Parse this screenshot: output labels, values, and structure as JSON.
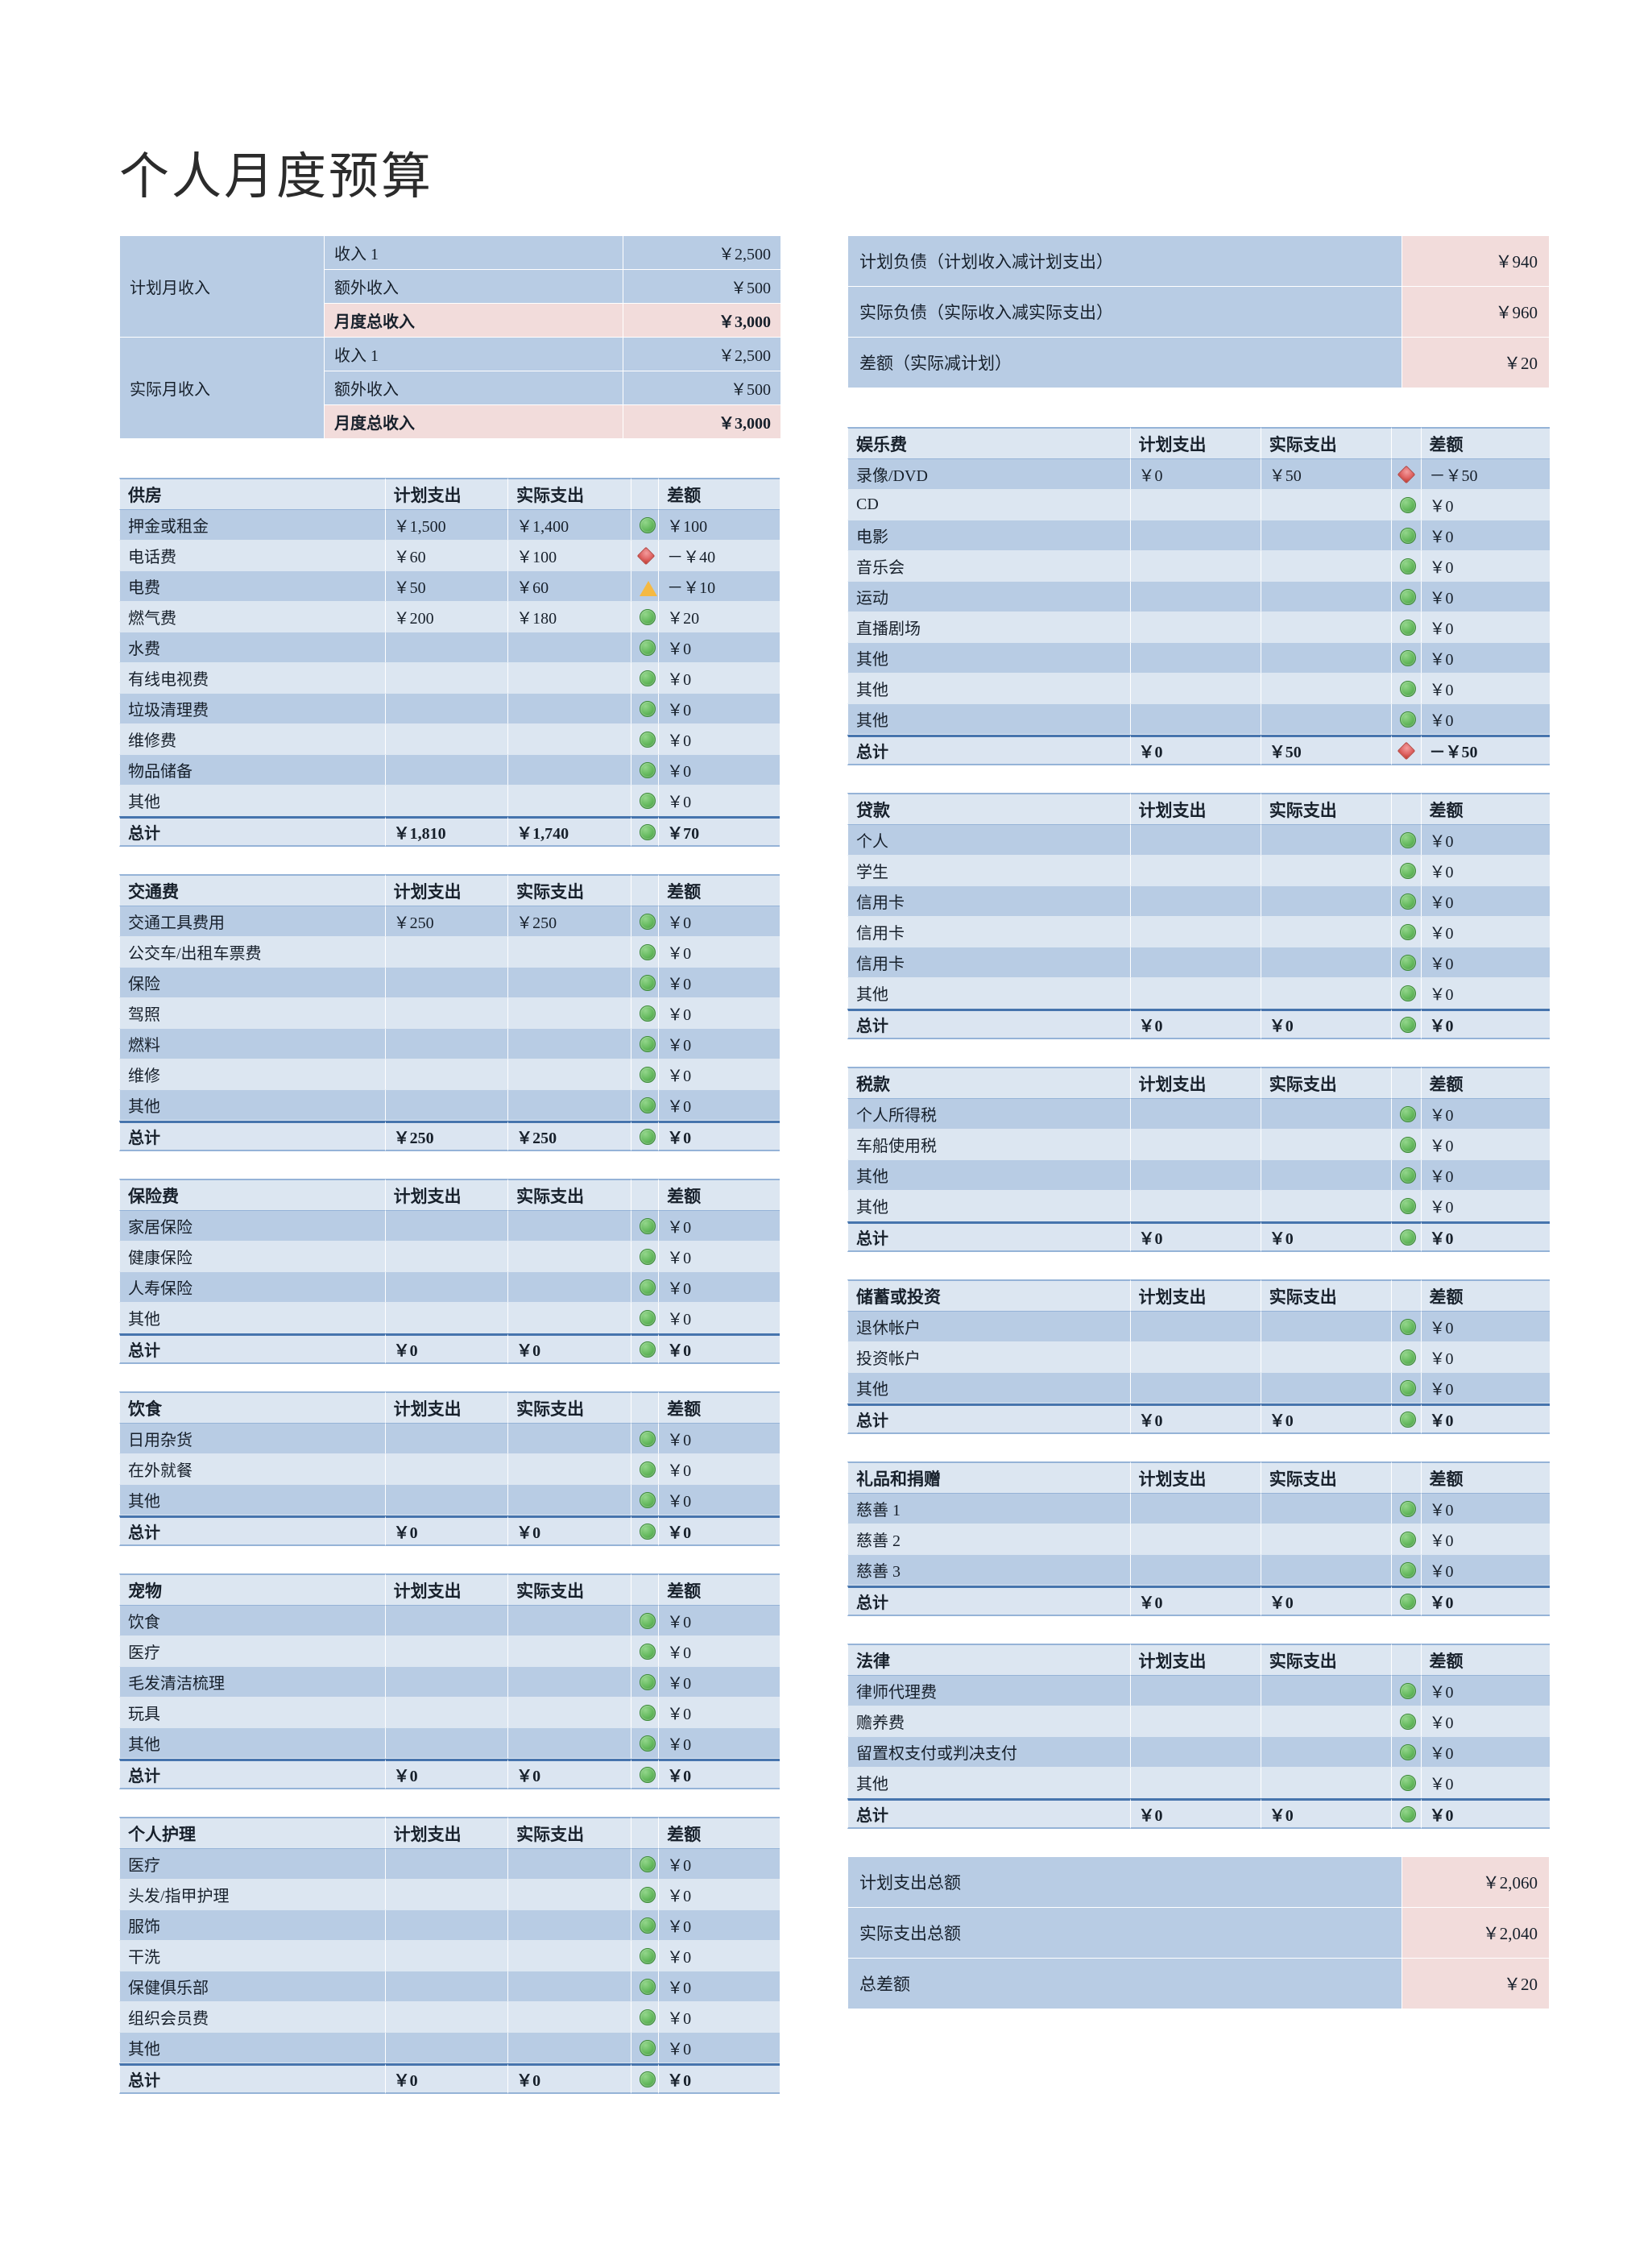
{
  "title": "个人月度预算",
  "currency_symbol": "¥",
  "income": {
    "planned_label": "计划月收入",
    "actual_label": "实际月收入",
    "planned_rows": [
      {
        "name": "收入 1",
        "value": "￥2,500",
        "total": false
      },
      {
        "name": "额外收入",
        "value": "￥500",
        "total": false
      },
      {
        "name": "月度总收入",
        "value": "￥3,000",
        "total": true
      }
    ],
    "actual_rows": [
      {
        "name": "收入 1",
        "value": "￥2,500",
        "total": false
      },
      {
        "name": "额外收入",
        "value": "￥500",
        "total": false
      },
      {
        "name": "月度总收入",
        "value": "￥3,000",
        "total": true
      }
    ]
  },
  "summary_top": [
    {
      "label": "计划负债（计划收入减计划支出）",
      "value": "￥940"
    },
    {
      "label": "实际负债（实际收入减实际支出）",
      "value": "￥960"
    },
    {
      "label": "差额（实际减计划）",
      "value": "￥20"
    }
  ],
  "headers": {
    "plan": "计划支出",
    "actual": "实际支出",
    "diff": "差额",
    "total": "总计"
  },
  "left_sections": [
    {
      "name": "供房",
      "rows": [
        {
          "name": "押金或租金",
          "plan": "￥1,500",
          "actual": "￥1,400",
          "icon": "green",
          "diff": "￥100"
        },
        {
          "name": "电话费",
          "plan": "￥60",
          "actual": "￥100",
          "icon": "red",
          "diff": "－￥40"
        },
        {
          "name": "电费",
          "plan": "￥50",
          "actual": "￥60",
          "icon": "yellow",
          "diff": "－￥10"
        },
        {
          "name": "燃气费",
          "plan": "￥200",
          "actual": "￥180",
          "icon": "green",
          "diff": "￥20"
        },
        {
          "name": "水费",
          "plan": "",
          "actual": "",
          "icon": "green",
          "diff": "￥0"
        },
        {
          "name": "有线电视费",
          "plan": "",
          "actual": "",
          "icon": "green",
          "diff": "￥0"
        },
        {
          "name": "垃圾清理费",
          "plan": "",
          "actual": "",
          "icon": "green",
          "diff": "￥0"
        },
        {
          "name": "维修费",
          "plan": "",
          "actual": "",
          "icon": "green",
          "diff": "￥0"
        },
        {
          "name": "物品储备",
          "plan": "",
          "actual": "",
          "icon": "green",
          "diff": "￥0"
        },
        {
          "name": "其他",
          "plan": "",
          "actual": "",
          "icon": "green",
          "diff": "￥0"
        }
      ],
      "total": {
        "name": "总计",
        "plan": "￥1,810",
        "actual": "￥1,740",
        "icon": "green",
        "diff": "￥70"
      }
    },
    {
      "name": "交通费",
      "rows": [
        {
          "name": "交通工具费用",
          "plan": "￥250",
          "actual": "￥250",
          "icon": "green",
          "diff": "￥0"
        },
        {
          "name": "公交车/出租车票费",
          "plan": "",
          "actual": "",
          "icon": "green",
          "diff": "￥0"
        },
        {
          "name": "保险",
          "plan": "",
          "actual": "",
          "icon": "green",
          "diff": "￥0"
        },
        {
          "name": "驾照",
          "plan": "",
          "actual": "",
          "icon": "green",
          "diff": "￥0"
        },
        {
          "name": "燃料",
          "plan": "",
          "actual": "",
          "icon": "green",
          "diff": "￥0"
        },
        {
          "name": "维修",
          "plan": "",
          "actual": "",
          "icon": "green",
          "diff": "￥0"
        },
        {
          "name": "其他",
          "plan": "",
          "actual": "",
          "icon": "green",
          "diff": "￥0"
        }
      ],
      "total": {
        "name": "总计",
        "plan": "￥250",
        "actual": "￥250",
        "icon": "green",
        "diff": "￥0"
      }
    },
    {
      "name": "保险费",
      "rows": [
        {
          "name": "家居保险",
          "plan": "",
          "actual": "",
          "icon": "green",
          "diff": "￥0"
        },
        {
          "name": "健康保险",
          "plan": "",
          "actual": "",
          "icon": "green",
          "diff": "￥0"
        },
        {
          "name": "人寿保险",
          "plan": "",
          "actual": "",
          "icon": "green",
          "diff": "￥0"
        },
        {
          "name": "其他",
          "plan": "",
          "actual": "",
          "icon": "green",
          "diff": "￥0"
        }
      ],
      "total": {
        "name": "总计",
        "plan": "￥0",
        "actual": "￥0",
        "icon": "green",
        "diff": "￥0"
      }
    },
    {
      "name": "饮食",
      "rows": [
        {
          "name": "日用杂货",
          "plan": "",
          "actual": "",
          "icon": "green",
          "diff": "￥0"
        },
        {
          "name": "在外就餐",
          "plan": "",
          "actual": "",
          "icon": "green",
          "diff": "￥0"
        },
        {
          "name": "其他",
          "plan": "",
          "actual": "",
          "icon": "green",
          "diff": "￥0"
        }
      ],
      "total": {
        "name": "总计",
        "plan": "￥0",
        "actual": "￥0",
        "icon": "green",
        "diff": "￥0"
      }
    },
    {
      "name": "宠物",
      "rows": [
        {
          "name": "饮食",
          "plan": "",
          "actual": "",
          "icon": "green",
          "diff": "￥0"
        },
        {
          "name": "医疗",
          "plan": "",
          "actual": "",
          "icon": "green",
          "diff": "￥0"
        },
        {
          "name": "毛发清洁梳理",
          "plan": "",
          "actual": "",
          "icon": "green",
          "diff": "￥0"
        },
        {
          "name": "玩具",
          "plan": "",
          "actual": "",
          "icon": "green",
          "diff": "￥0"
        },
        {
          "name": "其他",
          "plan": "",
          "actual": "",
          "icon": "green",
          "diff": "￥0"
        }
      ],
      "total": {
        "name": "总计",
        "plan": "￥0",
        "actual": "￥0",
        "icon": "green",
        "diff": "￥0"
      }
    },
    {
      "name": "个人护理",
      "rows": [
        {
          "name": "医疗",
          "plan": "",
          "actual": "",
          "icon": "green",
          "diff": "￥0"
        },
        {
          "name": "头发/指甲护理",
          "plan": "",
          "actual": "",
          "icon": "green",
          "diff": "￥0"
        },
        {
          "name": "服饰",
          "plan": "",
          "actual": "",
          "icon": "green",
          "diff": "￥0"
        },
        {
          "name": "干洗",
          "plan": "",
          "actual": "",
          "icon": "green",
          "diff": "￥0"
        },
        {
          "name": "保健俱乐部",
          "plan": "",
          "actual": "",
          "icon": "green",
          "diff": "￥0"
        },
        {
          "name": "组织会员费",
          "plan": "",
          "actual": "",
          "icon": "green",
          "diff": "￥0"
        },
        {
          "name": "其他",
          "plan": "",
          "actual": "",
          "icon": "green",
          "diff": "￥0"
        }
      ],
      "total": {
        "name": "总计",
        "plan": "￥0",
        "actual": "￥0",
        "icon": "green",
        "diff": "￥0"
      }
    }
  ],
  "right_sections": [
    {
      "name": "娱乐费",
      "rows": [
        {
          "name": "录像/DVD",
          "plan": "￥0",
          "actual": "￥50",
          "icon": "red",
          "diff": "－￥50"
        },
        {
          "name": "CD",
          "plan": "",
          "actual": "",
          "icon": "green",
          "diff": "￥0"
        },
        {
          "name": "电影",
          "plan": "",
          "actual": "",
          "icon": "green",
          "diff": "￥0"
        },
        {
          "name": "音乐会",
          "plan": "",
          "actual": "",
          "icon": "green",
          "diff": "￥0"
        },
        {
          "name": "运动",
          "plan": "",
          "actual": "",
          "icon": "green",
          "diff": "￥0"
        },
        {
          "name": "直播剧场",
          "plan": "",
          "actual": "",
          "icon": "green",
          "diff": "￥0"
        },
        {
          "name": "其他",
          "plan": "",
          "actual": "",
          "icon": "green",
          "diff": "￥0"
        },
        {
          "name": "其他",
          "plan": "",
          "actual": "",
          "icon": "green",
          "diff": "￥0"
        },
        {
          "name": "其他",
          "plan": "",
          "actual": "",
          "icon": "green",
          "diff": "￥0"
        }
      ],
      "total": {
        "name": "总计",
        "plan": "￥0",
        "actual": "￥50",
        "icon": "red",
        "diff": "－￥50"
      }
    },
    {
      "name": "贷款",
      "rows": [
        {
          "name": "个人",
          "plan": "",
          "actual": "",
          "icon": "green",
          "diff": "￥0"
        },
        {
          "name": "学生",
          "plan": "",
          "actual": "",
          "icon": "green",
          "diff": "￥0"
        },
        {
          "name": "信用卡",
          "plan": "",
          "actual": "",
          "icon": "green",
          "diff": "￥0"
        },
        {
          "name": "信用卡",
          "plan": "",
          "actual": "",
          "icon": "green",
          "diff": "￥0"
        },
        {
          "name": "信用卡",
          "plan": "",
          "actual": "",
          "icon": "green",
          "diff": "￥0"
        },
        {
          "name": "其他",
          "plan": "",
          "actual": "",
          "icon": "green",
          "diff": "￥0"
        }
      ],
      "total": {
        "name": "总计",
        "plan": "￥0",
        "actual": "￥0",
        "icon": "green",
        "diff": "￥0"
      }
    },
    {
      "name": "税款",
      "rows": [
        {
          "name": "个人所得税",
          "plan": "",
          "actual": "",
          "icon": "green",
          "diff": "￥0"
        },
        {
          "name": "车船使用税",
          "plan": "",
          "actual": "",
          "icon": "green",
          "diff": "￥0"
        },
        {
          "name": "其他",
          "plan": "",
          "actual": "",
          "icon": "green",
          "diff": "￥0"
        },
        {
          "name": "其他",
          "plan": "",
          "actual": "",
          "icon": "green",
          "diff": "￥0"
        }
      ],
      "total": {
        "name": "总计",
        "plan": "￥0",
        "actual": "￥0",
        "icon": "green",
        "diff": "￥0"
      }
    },
    {
      "name": "储蓄或投资",
      "rows": [
        {
          "name": "退休帐户",
          "plan": "",
          "actual": "",
          "icon": "green",
          "diff": "￥0"
        },
        {
          "name": "投资帐户",
          "plan": "",
          "actual": "",
          "icon": "green",
          "diff": "￥0"
        },
        {
          "name": "其他",
          "plan": "",
          "actual": "",
          "icon": "green",
          "diff": "￥0"
        }
      ],
      "total": {
        "name": "总计",
        "plan": "￥0",
        "actual": "￥0",
        "icon": "green",
        "diff": "￥0"
      }
    },
    {
      "name": "礼品和捐赠",
      "rows": [
        {
          "name": "慈善 1",
          "plan": "",
          "actual": "",
          "icon": "green",
          "diff": "￥0"
        },
        {
          "name": "慈善 2",
          "plan": "",
          "actual": "",
          "icon": "green",
          "diff": "￥0"
        },
        {
          "name": "慈善 3",
          "plan": "",
          "actual": "",
          "icon": "green",
          "diff": "￥0"
        }
      ],
      "total": {
        "name": "总计",
        "plan": "￥0",
        "actual": "￥0",
        "icon": "green",
        "diff": "￥0"
      }
    },
    {
      "name": "法律",
      "rows": [
        {
          "name": "律师代理费",
          "plan": "",
          "actual": "",
          "icon": "green",
          "diff": "￥0"
        },
        {
          "name": "赡养费",
          "plan": "",
          "actual": "",
          "icon": "green",
          "diff": "￥0"
        },
        {
          "name": "留置权支付或判决支付",
          "plan": "",
          "actual": "",
          "icon": "green",
          "diff": "￥0"
        },
        {
          "name": "其他",
          "plan": "",
          "actual": "",
          "icon": "green",
          "diff": "￥0"
        }
      ],
      "total": {
        "name": "总计",
        "plan": "￥0",
        "actual": "￥0",
        "icon": "green",
        "diff": "￥0"
      }
    }
  ],
  "summary_bottom": [
    {
      "label": "计划支出总额",
      "value": "￥2,060"
    },
    {
      "label": "实际支出总额",
      "value": "￥2,040"
    },
    {
      "label": "总差额",
      "value": "￥20"
    }
  ],
  "colors": {
    "header_blue": "#dce6f1",
    "row_blue_dark": "#b8cce4",
    "row_blue_light": "#dce6f1",
    "total_accent": "#4674ad",
    "pink": "#f2dcdb",
    "icon_green": "#63b85c",
    "icon_red": "#e06666",
    "icon_yellow": "#f5b942"
  }
}
